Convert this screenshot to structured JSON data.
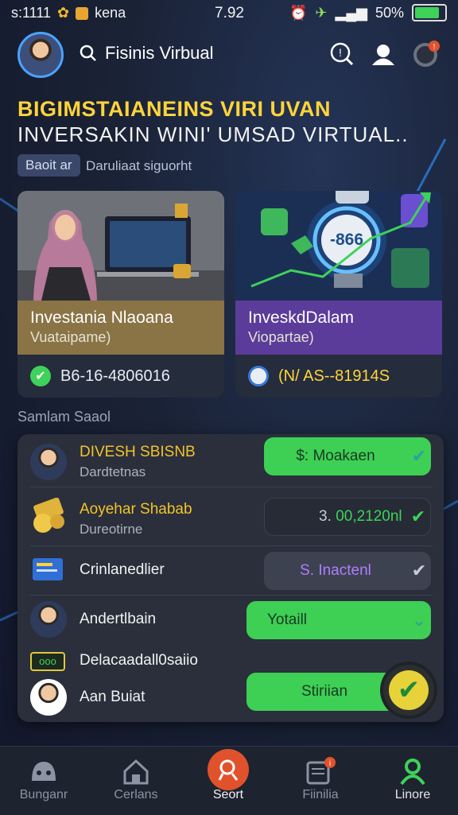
{
  "status_bar": {
    "left_text": "s:1111",
    "carrier": "kena",
    "time": "7.92",
    "battery": "50%"
  },
  "header": {
    "search_label": "Fisinis Virbual"
  },
  "hero": {
    "title": "BIGIMSTAIANEINS VIRI UVAN",
    "subtitle": "INVERSAKIN WINI' UMSAD VIRTUAL..",
    "chip": "Baoit ar",
    "chip_caption": "Daruliaat siguorht"
  },
  "cards": [
    {
      "title": "Investania Nlaoana",
      "subtitle": "Vuataipame)",
      "footer": "B6-16-4806016",
      "band_color": "#8a7445"
    },
    {
      "title": "InveskdDalam",
      "subtitle": "Viopartae)",
      "footer": "(N/ AS--81914S",
      "gauge": "-866",
      "band_color": "#5b3c9a"
    }
  ],
  "section_title": "Samlam Saaol",
  "rows": [
    {
      "name": "DIVESH SBISNB",
      "sub": "Dardtetnas",
      "action": "$: Moakaen",
      "name_color": "#f2c32a"
    },
    {
      "name": "Aoyehar Shabab",
      "sub": "Dureotirne",
      "amount_prefix": "3.",
      "action": "00,2120nl",
      "name_color": "#f2c32a"
    },
    {
      "name": "Crinlanedlier",
      "action": "S. Inactenl"
    },
    {
      "name": "Andertlbain",
      "action": "Yotaill"
    },
    {
      "name": "Delacaadall0saiio",
      "badge": "ooo"
    },
    {
      "name": "Aan Buiat",
      "action": "Stiriian"
    }
  ],
  "nav": [
    {
      "label": "Bunganr"
    },
    {
      "label": "Cerlans"
    },
    {
      "label": "Seort"
    },
    {
      "label": "Fiinilia"
    },
    {
      "label": "Linore"
    }
  ],
  "colors": {
    "accent_green": "#3ed25a",
    "accent_yellow": "#ffd43b",
    "accent_orange": "#e0522c",
    "accent_purple": "#b07cff"
  }
}
